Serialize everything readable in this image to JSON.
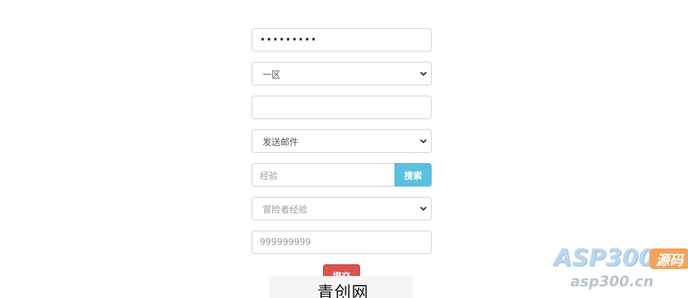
{
  "form": {
    "password_value": "•••••••••",
    "region_select": "一区",
    "blank_field_value": "",
    "action_select": "发送邮件",
    "search_input_value": "经验",
    "search_button_label": "搜索",
    "type_select": "冒险者经验",
    "amount_input_value": "999999999",
    "submit_label": "提交"
  },
  "footer": {
    "site_name": "青创网"
  },
  "watermark": {
    "brand": "ASP300",
    "badge": "源码",
    "url": "asp300.cn"
  },
  "colors": {
    "search_button": "#5bc0de",
    "submit_button": "#d9534f"
  },
  "icons": {
    "select_caret": "chevron-down-icon"
  }
}
